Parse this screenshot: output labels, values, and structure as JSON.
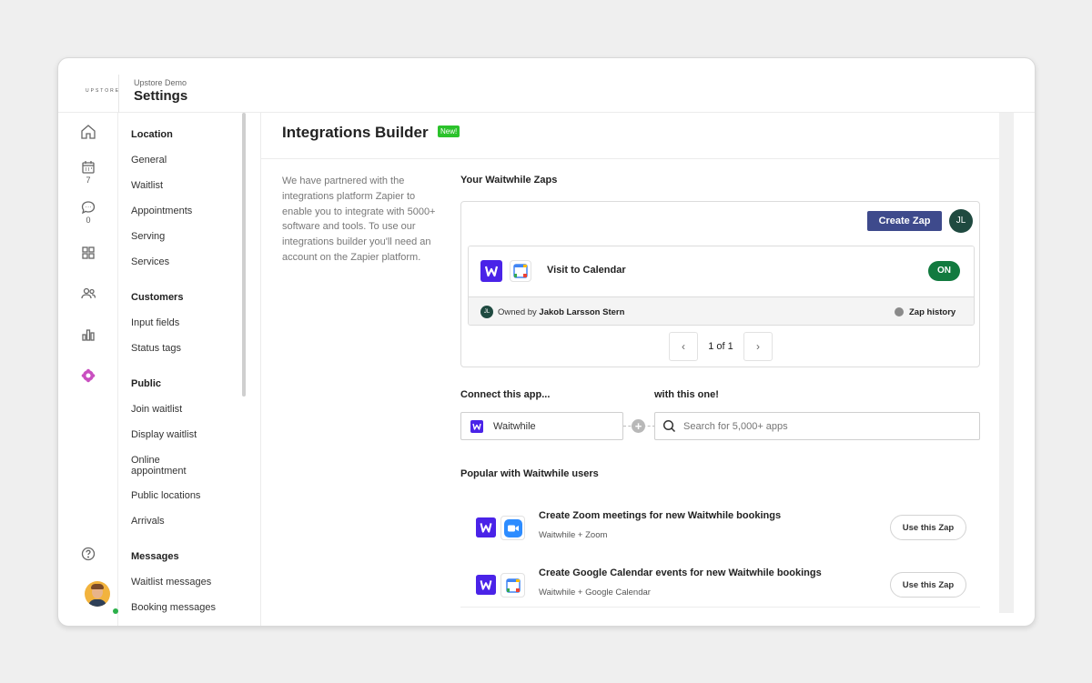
{
  "app": {
    "brand": "UPSTORE",
    "crumb": "Upstore Demo",
    "title": "Settings"
  },
  "rail": {
    "calendar_count": "7",
    "messages_count": "0"
  },
  "nav": {
    "sections": [
      {
        "heading": "Location",
        "items": [
          "General",
          "Waitlist",
          "Appointments",
          "Serving",
          "Services"
        ]
      },
      {
        "heading": "Customers",
        "items": [
          "Input fields",
          "Status tags"
        ]
      },
      {
        "heading": "Public",
        "items": [
          "Join waitlist",
          "Display waitlist",
          "Online appointment",
          "Public locations",
          "Arrivals"
        ]
      },
      {
        "heading": "Messages",
        "items": [
          "Waitlist messages",
          "Booking messages"
        ]
      }
    ]
  },
  "main": {
    "title": "Integrations Builder",
    "badge": "New!",
    "description": "We have partnered with the integrations platform Zapier to enable you to integrate with 5000+ software and tools. To use our integrations builder you'll need an account on the Zapier platform.",
    "zaps_label": "Your Waitwhile Zaps",
    "create_zap": "Create Zap",
    "user_initials": "JL",
    "zap": {
      "name": "Visit to Calendar",
      "status": "ON",
      "owner_prefix": "Owned by",
      "owner": "Jakob Larsson Stern",
      "history": "Zap history"
    },
    "pager": {
      "text": "1 of 1"
    },
    "connect_label": "Connect this app...",
    "with_label": "with this one!",
    "connect_app": "Waitwhile",
    "search_placeholder": "Search for 5,000+ apps",
    "popular_label": "Popular with Waitwhile users",
    "popular": [
      {
        "title": "Create Zoom meetings for new Waitwhile bookings",
        "sub": "Waitwhile + Zoom",
        "button": "Use this Zap"
      },
      {
        "title": "Create Google Calendar events for new Waitwhile bookings",
        "sub": "Waitwhile + Google Calendar",
        "button": "Use this Zap"
      }
    ]
  },
  "colors": {
    "accent": "#3e4a8c",
    "waitwhile": "#4a23e8",
    "on_green": "#127a3f",
    "new_badge": "#2bc22b"
  }
}
